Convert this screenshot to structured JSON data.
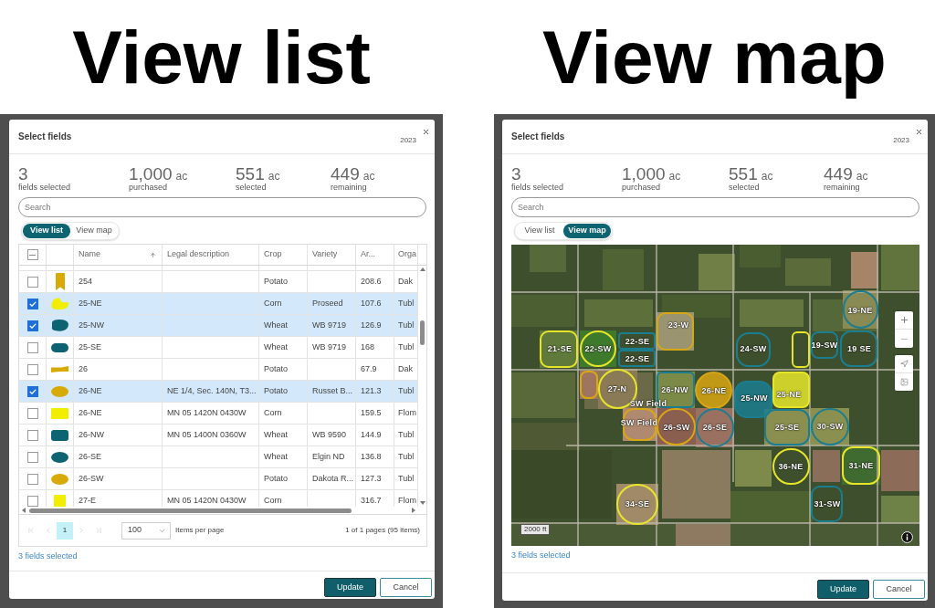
{
  "panels": [
    {
      "heading": "View list",
      "dialog": {
        "title": "Select fields",
        "year": "2023",
        "stats": [
          {
            "value": "3",
            "label": "fields selected"
          },
          {
            "value": "1,000",
            "unit": "ac",
            "label": "purchased"
          },
          {
            "value": "551",
            "unit": "ac",
            "label": "selected"
          },
          {
            "value": "449",
            "unit": "ac",
            "label": "remaining"
          }
        ],
        "search": {
          "placeholder": "Search"
        },
        "view_tabs": [
          {
            "label": "View list",
            "selected": true
          },
          {
            "label": "View map",
            "selected": false
          }
        ],
        "table": {
          "select_all": {
            "indeterminate": true
          },
          "columns": [
            {
              "label": "Name",
              "sorted": true
            },
            {
              "label": "Legal description"
            },
            {
              "label": "Crop"
            },
            {
              "label": "Variety"
            },
            {
              "label": "Ar..."
            },
            {
              "label": "Orga"
            }
          ],
          "rows": [
            {
              "checked": false,
              "color": "#d8aa05",
              "name": "254",
              "crop": "Potato",
              "column_5": "208.6",
              "column_6": "Dak"
            },
            {
              "checked": true,
              "color": "#f2ee00",
              "name": "25-NE",
              "crop": "Corn",
              "variety": "Proseed",
              "column_5": "107.6",
              "column_6": "Tubl"
            },
            {
              "checked": true,
              "color": "#0e6372",
              "name": "25-NW",
              "crop": "Wheat",
              "variety": "WB 9719",
              "column_5": "126.9",
              "column_6": "Tubl"
            },
            {
              "checked": false,
              "color": "#0e6372",
              "name": "25-SE",
              "crop": "Wheat",
              "variety": "WB 9719",
              "column_5": "168",
              "column_6": "Tubl"
            },
            {
              "checked": false,
              "color": "#d8aa05",
              "name": "26",
              "crop": "Potato",
              "column_5": "67.9",
              "column_6": "Dak"
            },
            {
              "checked": true,
              "color": "#d8aa05",
              "name": "26-NE",
              "legal_description": "NE 1/4, Sec. 140N, T3...",
              "crop": "Potato",
              "variety": "Russet B...",
              "column_5": "121.3",
              "column_6": "Tubl"
            },
            {
              "checked": false,
              "color": "#f2ee00",
              "name": "26-NE",
              "legal_description": "MN 05 1420N 0430W",
              "crop": "Corn",
              "column_5": "159.5",
              "column_6": "Flom"
            },
            {
              "checked": false,
              "color": "#0e6372",
              "name": "26-NW",
              "legal_description": "MN 05 1400N 0360W",
              "crop": "Wheat",
              "variety": "WB 9590",
              "column_5": "144.9",
              "column_6": "Tubl"
            },
            {
              "checked": false,
              "color": "#0e6372",
              "name": "26-SE",
              "crop": "Wheat",
              "variety": "Elgin ND",
              "column_5": "136.8",
              "column_6": "Tubl"
            },
            {
              "checked": false,
              "color": "#d8aa05",
              "name": "26-SW",
              "crop": "Potato",
              "variety": "Dakota R...",
              "column_5": "127.3",
              "column_6": "Tubl"
            },
            {
              "checked": false,
              "color": "#f2ee00",
              "name": "27-E",
              "legal_description": "MN 05 1420N 0430W",
              "crop": "Corn",
              "column_5": "316.7",
              "column_6": "Flom"
            }
          ]
        },
        "pagination": {
          "nav": [
            {
              "kind": "first",
              "disabled": true
            },
            {
              "kind": "previous",
              "disabled": true
            },
            {
              "kind": "next",
              "disabled": true
            },
            {
              "kind": "last",
              "disabled": true
            }
          ],
          "pages": [
            {
              "label": "1",
              "selected": true
            }
          ],
          "page_size": "100",
          "page_size_label": "Items per page",
          "summary": "1 of 1 pages (95 items)"
        },
        "selection_link": "3 fields selected",
        "buttons": [
          {
            "label": "Update",
            "kind": "primary"
          },
          {
            "label": "Cancel",
            "kind": "secondary"
          }
        ]
      }
    },
    {
      "heading": "View map",
      "dialog": {
        "title": "Select fields",
        "year": "2023",
        "stats": [
          {
            "value": "3",
            "label": "fields selected"
          },
          {
            "value": "1,000",
            "unit": "ac",
            "label": "purchased"
          },
          {
            "value": "551",
            "unit": "ac",
            "label": "selected"
          },
          {
            "value": "449",
            "unit": "ac",
            "label": "remaining"
          }
        ],
        "search": {
          "placeholder": "Search"
        },
        "view_tabs": [
          {
            "label": "View list",
            "selected": false
          },
          {
            "label": "View map",
            "selected": true
          }
        ],
        "map": {
          "fields": [
            {
              "label": "19-NE",
              "color": "#1a7d90",
              "selected": false
            },
            {
              "label": "23-W",
              "color": "#d9a614",
              "selected": false
            },
            {
              "label": "21-SE",
              "color": "#e6e52a",
              "selected": false
            },
            {
              "label": "22-SW",
              "color": "#e6e52a",
              "selected": false
            },
            {
              "label": "22-SE",
              "color": "#1a7d90",
              "selected": false
            },
            {
              "label": "22-SE",
              "color": "#1a7d90",
              "selected": false
            },
            {
              "label": "24-SW",
              "color": "#1a7d90",
              "selected": false
            },
            {
              "color": "#e6e52a",
              "selected": false
            },
            {
              "label": "19-SW",
              "color": "#1a7d90",
              "selected": false
            },
            {
              "label": "19 SE",
              "color": "#1a7d90",
              "selected": false
            },
            {
              "color": "#d9a614",
              "selected": false
            },
            {
              "label": "27-N",
              "color": "#e6e52a",
              "selected": false
            },
            {
              "label": "26-NW",
              "color": "#1a7d90",
              "selected": false
            },
            {
              "label": "26-NE",
              "color": "#d9a614",
              "selected": true
            },
            {
              "label": "25-NW",
              "color": "#1a7d90",
              "selected": true
            },
            {
              "label": "25-NE",
              "color": "#e6e52a",
              "selected": true
            },
            {
              "label": "SW Field"
            },
            {
              "label": "SW Field",
              "color": "#d9a614",
              "selected": false
            },
            {
              "label": "26-SW",
              "color": "#d9a614",
              "selected": false
            },
            {
              "label": "26-SE",
              "color": "#1a7d90",
              "selected": false
            },
            {
              "label": "25-SE",
              "color": "#1a7d90",
              "selected": false
            },
            {
              "label": "30-SW",
              "color": "#1a7d90",
              "selected": false
            },
            {
              "label": "36-NE",
              "color": "#e6e52a",
              "selected": false
            },
            {
              "label": "31-NE",
              "color": "#e6e52a",
              "selected": false
            },
            {
              "label": "34-SE",
              "color": "#e6e52a",
              "selected": false
            },
            {
              "label": "31-SW",
              "color": "#1a7d90",
              "selected": false
            }
          ],
          "scale": "2000 ft"
        },
        "selection_link": "3 fields selected",
        "buttons": [
          {
            "label": "Update",
            "kind": "primary"
          },
          {
            "label": "Cancel",
            "kind": "secondary"
          }
        ]
      }
    }
  ]
}
